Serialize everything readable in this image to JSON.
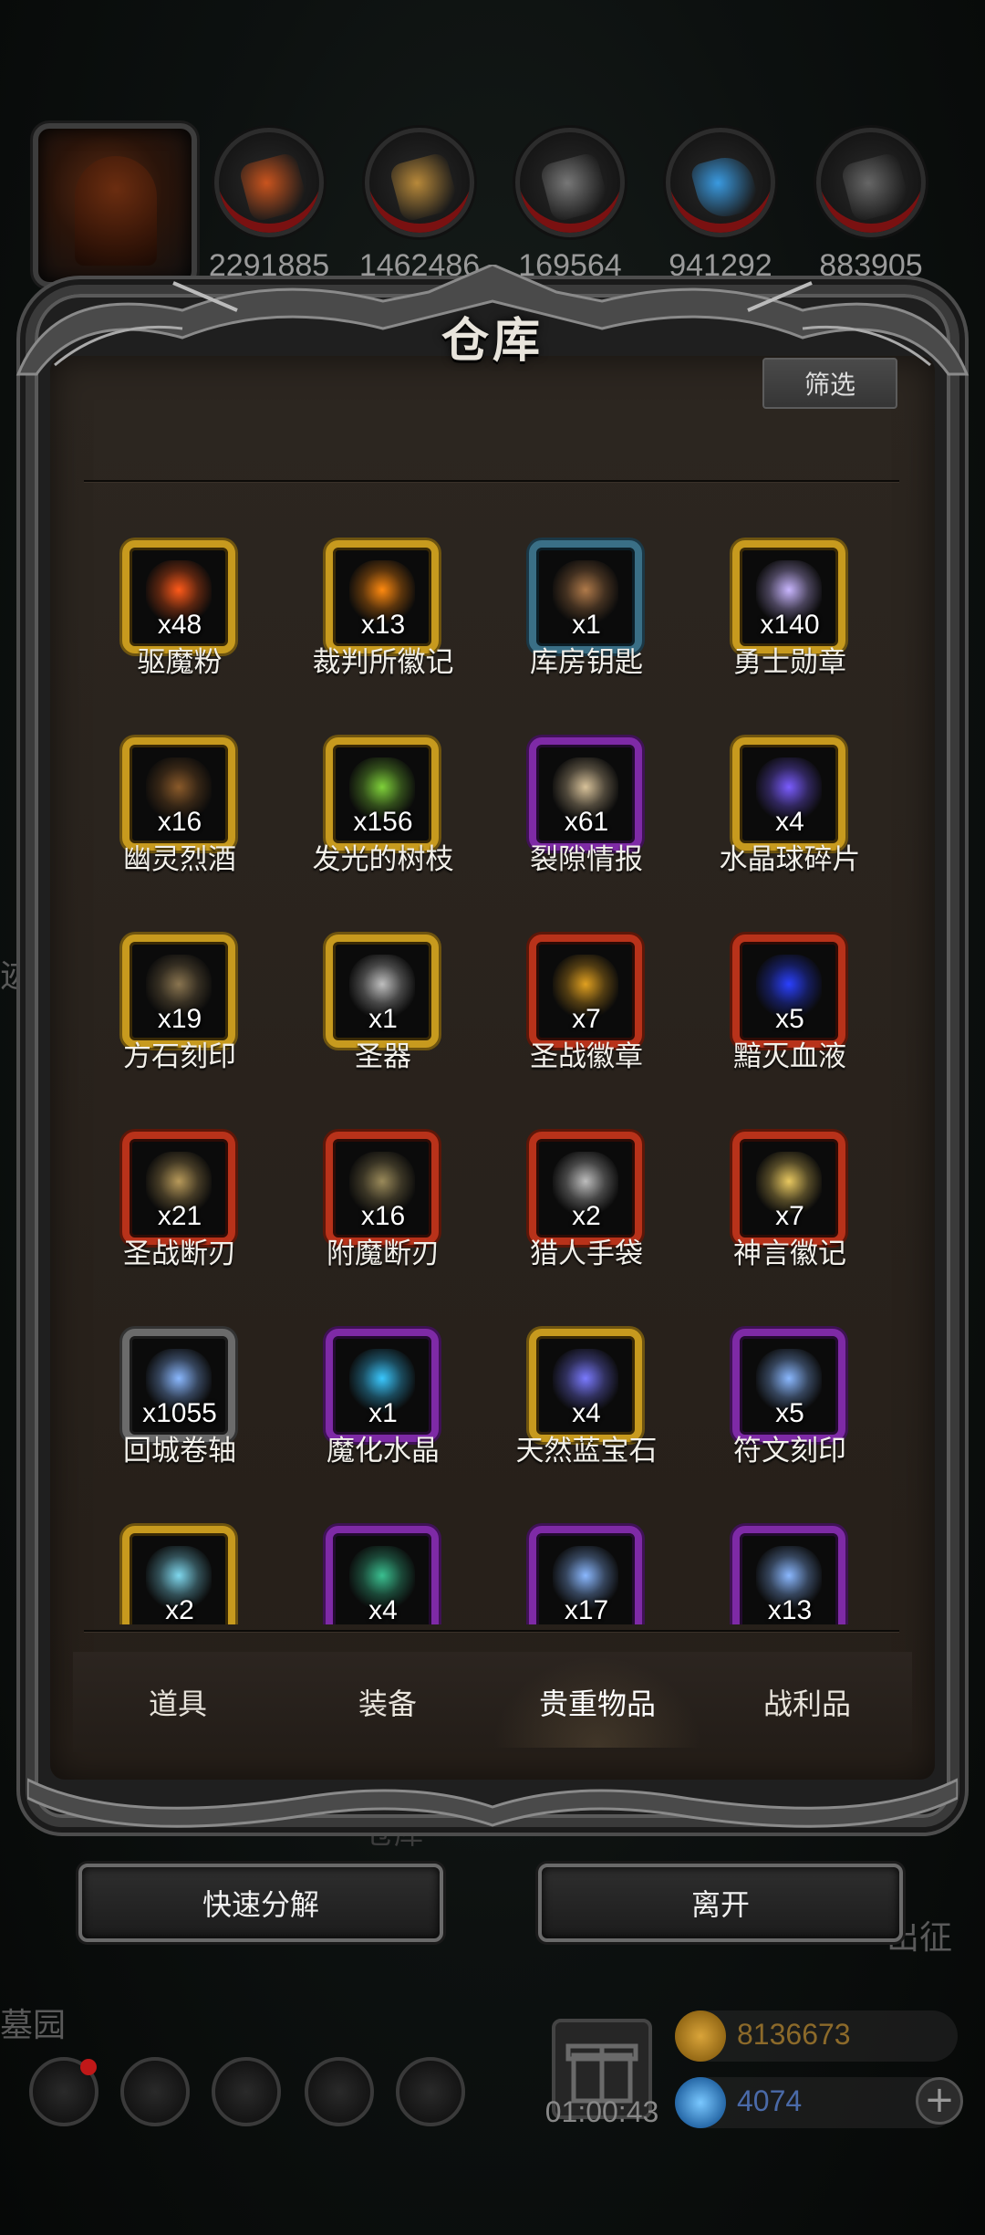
{
  "resources": [
    {
      "icon": "meat-icon",
      "value": "2291885"
    },
    {
      "icon": "wood-icon",
      "value": "1462486"
    },
    {
      "icon": "iron-icon",
      "value": "169564"
    },
    {
      "icon": "crystal-icon",
      "value": "941292"
    },
    {
      "icon": "stone-icon",
      "value": "883905"
    }
  ],
  "panel": {
    "title": "仓库",
    "filter_label": "筛选"
  },
  "items": [
    {
      "name": "驱魔粉",
      "count": "x48",
      "rarity": "gold",
      "icon": "powder-icon",
      "accent": "#ff5a1a"
    },
    {
      "name": "裁判所徽记",
      "count": "x13",
      "rarity": "gold",
      "icon": "emblem-icon",
      "accent": "#ff8a10"
    },
    {
      "name": "库房钥匙",
      "count": "x1",
      "rarity": "blue",
      "icon": "key-icon",
      "accent": "#b07a4a"
    },
    {
      "name": "勇士勋章",
      "count": "x140",
      "rarity": "gold",
      "icon": "medal-icon",
      "accent": "#c9b6ff"
    },
    {
      "name": "幽灵烈酒",
      "count": "x16",
      "rarity": "gold",
      "icon": "barrel-icon",
      "accent": "#8a5a2a"
    },
    {
      "name": "发光的树枝",
      "count": "x156",
      "rarity": "gold",
      "icon": "branch-icon",
      "accent": "#7fd13a"
    },
    {
      "name": "裂隙情报",
      "count": "x61",
      "rarity": "purple",
      "icon": "scroll-icon",
      "accent": "#d8c29a"
    },
    {
      "name": "水晶球碎片",
      "count": "x4",
      "rarity": "gold",
      "icon": "orb-shard-icon",
      "accent": "#7a5cff"
    },
    {
      "name": "方石刻印",
      "count": "x19",
      "rarity": "gold",
      "icon": "stone-block-icon",
      "accent": "#8a7550"
    },
    {
      "name": "圣器",
      "count": "x1",
      "rarity": "gold",
      "icon": "relic-icon",
      "accent": "#bfbfbf"
    },
    {
      "name": "圣战徽章",
      "count": "x7",
      "rarity": "red",
      "icon": "shield-icon",
      "accent": "#e0a020"
    },
    {
      "name": "黯灭血液",
      "count": "x5",
      "rarity": "red",
      "icon": "blood-drop-icon",
      "accent": "#2a40ff"
    },
    {
      "name": "圣战断刃",
      "count": "x21",
      "rarity": "red",
      "icon": "dagger-icon",
      "accent": "#b89a5a"
    },
    {
      "name": "附魔断刃",
      "count": "x16",
      "rarity": "red",
      "icon": "dagger-icon",
      "accent": "#9a8a5a"
    },
    {
      "name": "猎人手袋",
      "count": "x2",
      "rarity": "red",
      "icon": "pouch-icon",
      "accent": "#bdbdbd"
    },
    {
      "name": "神言徽记",
      "count": "x7",
      "rarity": "red",
      "icon": "sun-emblem-icon",
      "accent": "#e8c860"
    },
    {
      "name": "回城卷轴",
      "count": "x1055",
      "rarity": "grey",
      "icon": "swirl-icon",
      "accent": "#8ab8ff"
    },
    {
      "name": "魔化水晶",
      "count": "x1",
      "rarity": "purple",
      "icon": "crystal-icon",
      "accent": "#3ac8ff"
    },
    {
      "name": "天然蓝宝石",
      "count": "x4",
      "rarity": "gold",
      "icon": "sapphire-icon",
      "accent": "#7a7aff"
    },
    {
      "name": "符文刻印",
      "count": "x5",
      "rarity": "purple",
      "icon": "swirl-icon",
      "accent": "#8ab8ff"
    },
    {
      "name": "",
      "count": "x2",
      "rarity": "gold",
      "icon": "ice-ingot-icon",
      "accent": "#7fd8ee"
    },
    {
      "name": "",
      "count": "x4",
      "rarity": "purple",
      "icon": "green-crystal-icon",
      "accent": "#3ac090"
    },
    {
      "name": "",
      "count": "x17",
      "rarity": "purple",
      "icon": "swirl-icon",
      "accent": "#8ab8ff"
    },
    {
      "name": "",
      "count": "x13",
      "rarity": "purple",
      "icon": "swirl-icon",
      "accent": "#8ab8ff"
    }
  ],
  "tabs": [
    {
      "label": "道具",
      "active": false
    },
    {
      "label": "装备",
      "active": false
    },
    {
      "label": "贵重物品",
      "active": true
    },
    {
      "label": "战利品",
      "active": false
    }
  ],
  "actions": {
    "quick_decompose": "快速分解",
    "leave": "离开"
  },
  "background": {
    "text_left": "迹",
    "text_right": "出征",
    "text_cemetery": "墓园",
    "text_warehouse": "仓库",
    "timer": "01:00:43",
    "gold": "8136673",
    "gems": "4074",
    "plus": "+"
  }
}
